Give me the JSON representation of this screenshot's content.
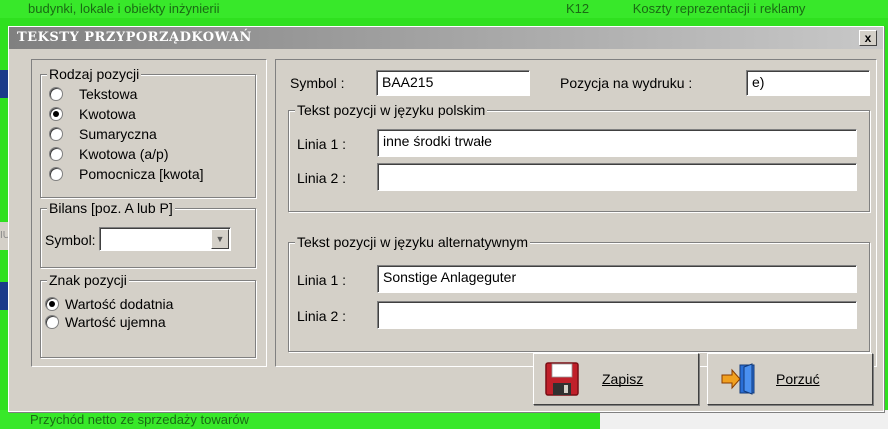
{
  "background": {
    "top_left_text": "budynki, lokale i obiekty inżynierii",
    "top_right_code": "K12",
    "top_right_text": "Koszty reprezentacji i reklamy",
    "bottom_left_text": "Przychód netto ze sprzedaży towarów",
    "left_gray_text": "IU"
  },
  "dialog": {
    "title": "TEKSTY PRZYPORZĄDKOWAŃ",
    "close_label": "x"
  },
  "rodzaj": {
    "legend": "Rodzaj pozycji",
    "options": [
      {
        "label": "Tekstowa",
        "checked": false
      },
      {
        "label": "Kwotowa",
        "checked": true
      },
      {
        "label": "Sumaryczna",
        "checked": false
      },
      {
        "label": "Kwotowa (a/p)",
        "checked": false
      },
      {
        "label": "Pomocnicza [kwota]",
        "checked": false
      }
    ]
  },
  "bilans": {
    "legend": "Bilans [poz. A lub P]",
    "symbol_label": "Symbol:",
    "symbol_value": ""
  },
  "znak": {
    "legend": "Znak pozycji",
    "options": [
      {
        "label": "Wartość dodatnia",
        "checked": true
      },
      {
        "label": "Wartość ujemna",
        "checked": false
      }
    ]
  },
  "symbol": {
    "label": "Symbol :",
    "value": "BAA215"
  },
  "pozycja": {
    "label": "Pozycja na wydruku :",
    "value": "e)"
  },
  "polski": {
    "legend": "Tekst pozycji w języku polskim",
    "line1_label": "Linia 1 :",
    "line1_value": "inne środki trwałe",
    "line2_label": "Linia 2 :",
    "line2_value": ""
  },
  "alternatywny": {
    "legend": "Tekst pozycji w języku alternatywnym",
    "line1_label": "Linia 1 :",
    "line1_value": "Sonstige Anlageguter",
    "line2_label": "Linia 2 :",
    "line2_value": ""
  },
  "buttons": {
    "save_label": "Zapisz",
    "cancel_label": "Porzuć"
  }
}
